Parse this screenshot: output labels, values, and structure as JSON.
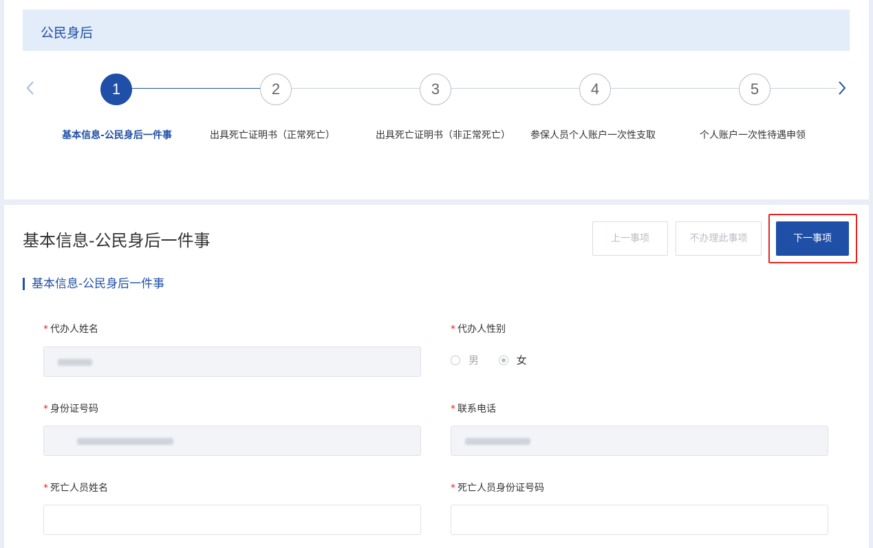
{
  "header": {
    "title": "公民身后"
  },
  "steps": [
    {
      "number": "1",
      "label": "基本信息-公民身后一件事",
      "active": true
    },
    {
      "number": "2",
      "label": "出具死亡证明书（正常死亡）",
      "active": false
    },
    {
      "number": "3",
      "label": "出具死亡证明书（非正常死亡）",
      "active": false
    },
    {
      "number": "4",
      "label": "参保人员个人账户一次性支取",
      "active": false
    },
    {
      "number": "5",
      "label": "个人账户一次性待遇申领",
      "active": false
    }
  ],
  "main": {
    "title": "基本信息-公民身后一件事",
    "buttons": {
      "prev": "上一事项",
      "skip": "不办理此事项",
      "next": "下一事项"
    },
    "section_title": "基本信息-公民身后一件事",
    "required_mark": "*",
    "fields": {
      "agent_name": {
        "label": "代办人姓名",
        "value": ""
      },
      "agent_gender": {
        "label": "代办人性别",
        "options": [
          "男",
          "女"
        ],
        "selected": "女"
      },
      "id_number": {
        "label": "身份证号码",
        "value": ""
      },
      "phone": {
        "label": "联系电话",
        "value": ""
      },
      "deceased_name": {
        "label": "死亡人员姓名",
        "value": ""
      },
      "deceased_id": {
        "label": "死亡人员身份证号码",
        "value": ""
      }
    }
  },
  "colors": {
    "accent": "#1f4fa6",
    "required": "#e8231f",
    "highlight": "#e8231f",
    "header_bg": "#e3ecf9"
  }
}
